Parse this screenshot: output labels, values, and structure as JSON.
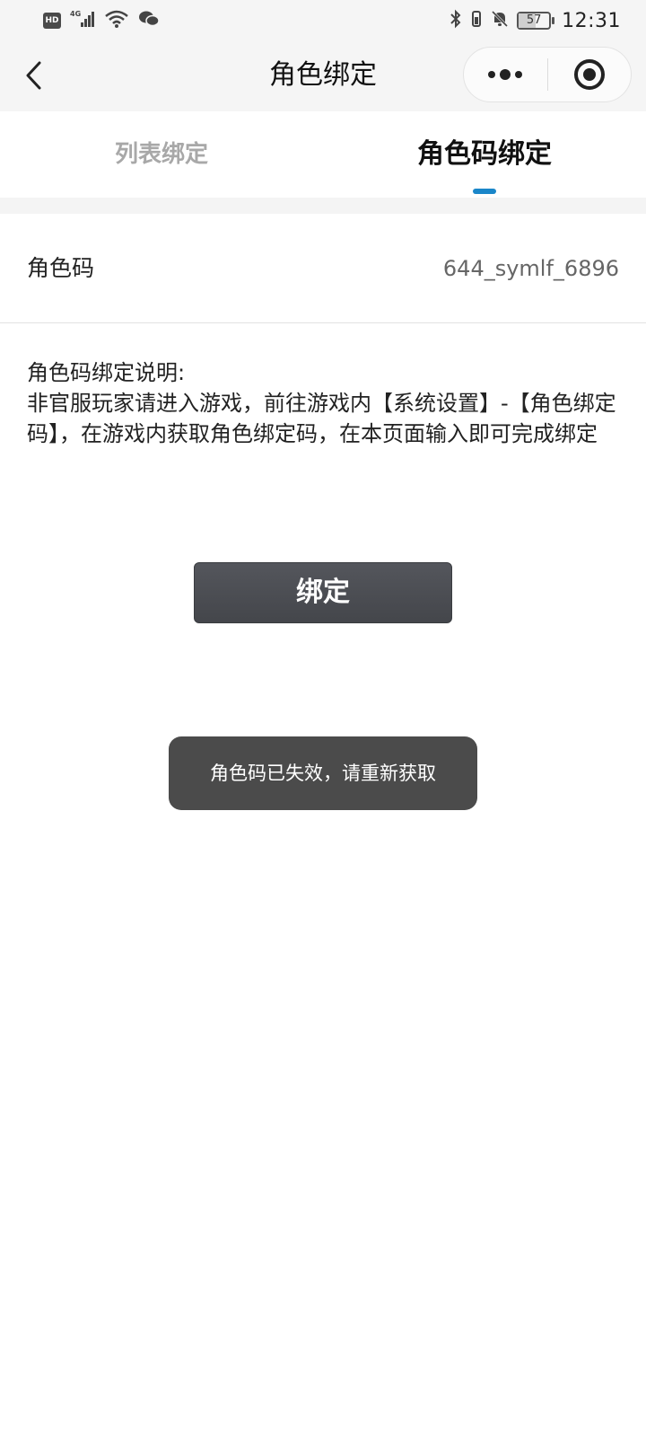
{
  "status_bar": {
    "hd": "HD",
    "network": "4G",
    "battery": "57",
    "time": "12:31",
    "icons": [
      "hd-icon",
      "signal-4g-icon",
      "wifi-icon",
      "wechat-icon",
      "bluetooth-icon",
      "vibrate-icon",
      "mute-bell-icon",
      "battery-icon"
    ]
  },
  "nav": {
    "title": "角色绑定",
    "back_icon": "chevron-left-icon",
    "more_icon": "more-dots-icon",
    "close_icon": "target-close-icon"
  },
  "tabs": [
    {
      "label": "列表绑定",
      "active": false
    },
    {
      "label": "角色码绑定",
      "active": true
    }
  ],
  "form": {
    "code_label": "角色码",
    "code_value": "644_symlf_6896"
  },
  "description": {
    "title": "角色码绑定说明:",
    "body": "非官服玩家请进入游戏，前往游戏内【系统设置】-【角色绑定码】，在游戏内获取角色绑定码，在本页面输入即可完成绑定"
  },
  "bind_button": {
    "label": "绑定"
  },
  "toast": {
    "message": "角色码已失效，请重新获取"
  },
  "colors": {
    "tab_indicator": "#1a86c9",
    "button_bg": "#4c4e53",
    "toast_bg": "#4b4b4b",
    "header_bg": "#f5f5f5"
  }
}
